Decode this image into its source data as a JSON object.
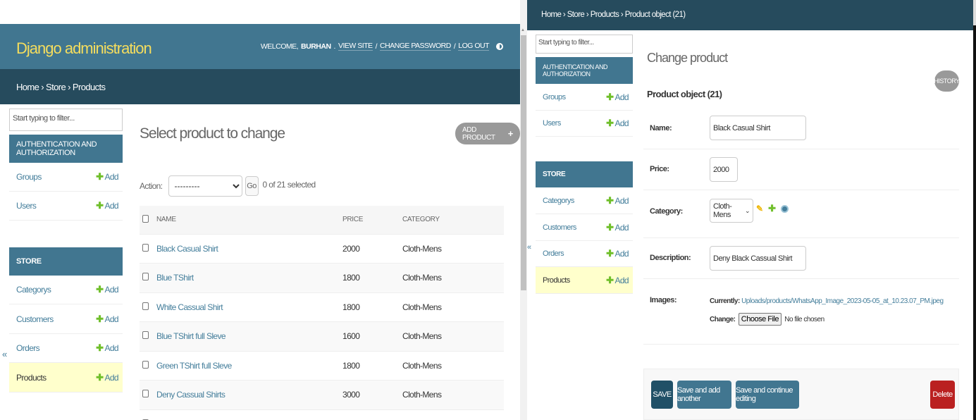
{
  "colors": {
    "header": "#417690",
    "breadcrumbs": "#264b5d",
    "branding": "#f5dd5d",
    "link": "#447e9b",
    "add_plus": "#70bf2b",
    "selected_row": "#ffffcc",
    "delete": "#ba2121"
  },
  "left": {
    "branding": "Django administration",
    "user_tools": {
      "welcome": "WELCOME,",
      "username": "BURHAN",
      "period": ".",
      "view_site": "VIEW SITE",
      "sep": "/",
      "change_password": "CHANGE PASSWORD",
      "log_out": "LOG OUT",
      "theme_icon": "theme-toggle-icon"
    },
    "breadcrumbs": {
      "home": "Home",
      "sep": "›",
      "app": "Store",
      "current": "Products"
    },
    "nav": {
      "filter_placeholder": "Start typing to filter...",
      "auth_caption": "AUTHENTICATION AND AUTHORIZATION",
      "auth_models": [
        {
          "name": "Groups",
          "add": "Add"
        },
        {
          "name": "Users",
          "add": "Add"
        }
      ],
      "store_caption": "STORE",
      "store_models": [
        {
          "name": "Categorys",
          "add": "Add"
        },
        {
          "name": "Customers",
          "add": "Add"
        },
        {
          "name": "Orders",
          "add": "Add"
        },
        {
          "name": "Products",
          "add": "Add"
        }
      ],
      "collapse": "«"
    },
    "title": "Select product to change",
    "add_button": "ADD PRODUCT",
    "add_button_icon": "+",
    "actions": {
      "label": "Action:",
      "selected_option": "---------",
      "go": "Go",
      "counter": "0 of 21 selected"
    },
    "table": {
      "columns": [
        "NAME",
        "PRICE",
        "CATEGORY"
      ],
      "rows": [
        {
          "name": "Black Casual Shirt",
          "price": "2000",
          "category": "Cloth-Mens"
        },
        {
          "name": "Blue TShirt",
          "price": "1800",
          "category": "Cloth-Mens"
        },
        {
          "name": "White Cassual Shirt",
          "price": "1800",
          "category": "Cloth-Mens"
        },
        {
          "name": "Blue TShirt full Sleve",
          "price": "1600",
          "category": "Cloth-Mens"
        },
        {
          "name": "Green TShirt full Sleve",
          "price": "1800",
          "category": "Cloth-Mens"
        },
        {
          "name": "Deny Cassual Shirts",
          "price": "3000",
          "category": "Cloth-Mens"
        }
      ]
    }
  },
  "right": {
    "breadcrumbs": {
      "home": "Home",
      "sep": "›",
      "app": "Store",
      "model": "Products",
      "current": "Product object (21)"
    },
    "nav": {
      "filter_placeholder": "Start typing to filter...",
      "auth_caption": "AUTHENTICATION AND AUTHORIZATION",
      "auth_models": [
        {
          "name": "Groups",
          "add": "Add"
        },
        {
          "name": "Users",
          "add": "Add"
        }
      ],
      "store_caption": "STORE",
      "store_models": [
        {
          "name": "Categorys",
          "add": "Add"
        },
        {
          "name": "Customers",
          "add": "Add"
        },
        {
          "name": "Orders",
          "add": "Add"
        },
        {
          "name": "Products",
          "add": "Add"
        }
      ],
      "expand": "«"
    },
    "title": "Change product",
    "history": "HISTORY",
    "object_title": "Product object (21)",
    "form": {
      "name_label": "Name:",
      "name_value": "Black Casual Shirt",
      "price_label": "Price:",
      "price_value": "2000",
      "category_label": "Category:",
      "category_value": "Cloth-Mens",
      "category_icons": [
        "pencil-icon",
        "plus-icon",
        "eye-icon"
      ],
      "description_label": "Description:",
      "description_value": "Deny Black Cassual Shirt",
      "images_label": "Images:",
      "currently_label": "Currently:",
      "currently_value": "Uploads/products/WhatsApp_Image_2023-05-05_at_10.23.07_PM.jpeg",
      "change_label": "Change:",
      "choose_file": "Choose File",
      "no_file": "No file chosen"
    },
    "buttons": {
      "save": "SAVE",
      "save_add_another": "Save and add another",
      "save_continue": "Save and continue editing",
      "delete": "Delete"
    }
  }
}
